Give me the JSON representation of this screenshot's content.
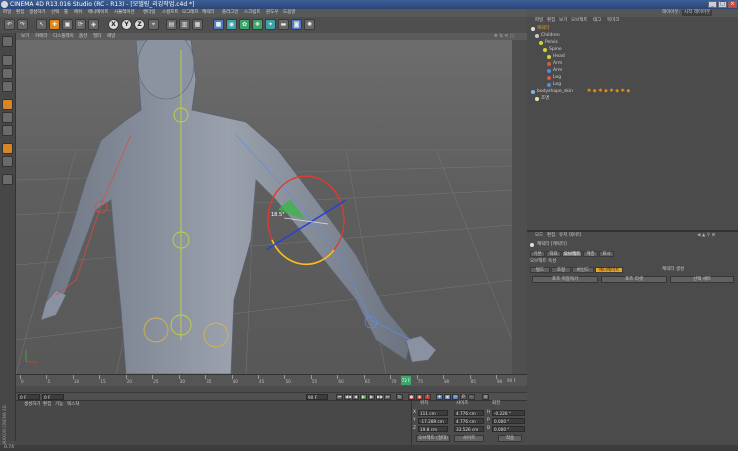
{
  "window": {
    "title": "CINEMA 4D R13.016 Studio (RC - R13) - [모델링_리깅작업.c4d *]",
    "controls": [
      "_",
      "□",
      "×"
    ]
  },
  "menubar": {
    "items": [
      "파일",
      "편집",
      "생성하기",
      "선택",
      "툴",
      "메쉬",
      "애니메이트",
      "시뮬레이션",
      "렌더링",
      "스컬프트",
      "모그래프",
      "캐릭터",
      "플러그인",
      "스크립트",
      "윈도우",
      "도움말"
    ],
    "layout_label": "레이아웃:",
    "layout_value": "시작 레이아웃"
  },
  "toolbar": {
    "axis_x": "X",
    "axis_y": "Y",
    "axis_z": "Z"
  },
  "viewport": {
    "menu": [
      "보기",
      "카메라",
      "디스플레이",
      "옵션",
      "필터",
      "패널"
    ],
    "angle_readout": "18.5°"
  },
  "object_manager": {
    "menu": [
      "파일",
      "편집",
      "보기",
      "오브젝트",
      "태그",
      "북마크"
    ],
    "objects": [
      {
        "name": "캐릭터",
        "selected": true
      },
      {
        "name": "Children",
        "selected": false
      },
      {
        "name": "Pelvis",
        "selected": false
      },
      {
        "name": "Spine",
        "selected": false
      },
      {
        "name": "Head",
        "selected": false
      },
      {
        "name": "Arm",
        "selected": false
      },
      {
        "name": "Arm",
        "selected": false
      },
      {
        "name": "Leg",
        "selected": false
      },
      {
        "name": "Leg",
        "selected": false
      },
      {
        "name": "bodyshape_skin",
        "selected": false
      },
      {
        "name": "조명",
        "selected": false
      }
    ]
  },
  "attribute_manager": {
    "menu": [
      "모드",
      "편집",
      "유저 데이터"
    ],
    "object_label": "캐릭터 [캐릭터]",
    "tabs": [
      "기본",
      "좌표",
      "오브젝트",
      "계층",
      "표시"
    ],
    "section_title": "오브젝트 속성",
    "subtabs": [
      "빌드",
      "조정",
      "바인드",
      "애니메이트"
    ],
    "right_label": "캐릭터 생성",
    "buttons": [
      "포즈 저장하기",
      "포즈 리셋",
      "선택 세트"
    ]
  },
  "timeline": {
    "ticks": [
      "0",
      "5",
      "10",
      "15",
      "20",
      "25",
      "30",
      "35",
      "40",
      "45",
      "50",
      "55",
      "60",
      "65",
      "70",
      "75",
      "80",
      "85",
      "90"
    ],
    "end_label": "90 F",
    "current_frame": "72 F",
    "current_frame_fraction": 0.8,
    "start_field": "0 F",
    "min_field": "0 F",
    "max_field": "90 F"
  },
  "material_manager": {
    "menu": [
      "생성하기",
      "편집",
      "기능",
      "텍스처"
    ]
  },
  "coordinates": {
    "headers": [
      "위치",
      "사이즈",
      "회전"
    ],
    "rows": [
      {
        "axis": "X",
        "pos": "111 cm",
        "size": "4.776 cm",
        "rot_label": "H",
        "rot": "-0.226 °"
      },
      {
        "axis": "Y",
        "pos": "-17.289 cm",
        "size": "4.776 cm",
        "rot_label": "P",
        "rot": "0.000 °"
      },
      {
        "axis": "Z",
        "pos": "19.8 cm",
        "size": "33.526 cm",
        "rot_label": "B",
        "rot": "0.000 °"
      }
    ],
    "mode_value": "오브젝트 (절대)",
    "size_mode": "사이즈",
    "apply_label": "적용"
  },
  "side_logo": "MAXON CINEMA 4D",
  "status": {
    "text": "0.74"
  },
  "colors": {
    "title_bar": "#2b4677",
    "accent_orange": "#e9a520",
    "selection": "#f0a030",
    "axis_x": "#e03a2e",
    "axis_y": "#3ab54a",
    "axis_z": "#2b3fd6"
  }
}
